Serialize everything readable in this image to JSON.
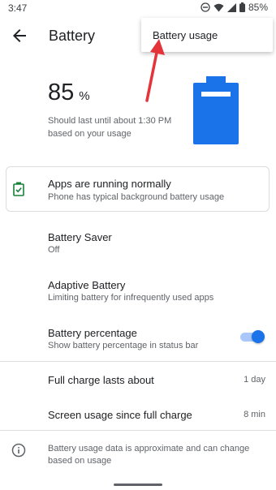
{
  "status_bar": {
    "time": "3:47",
    "battery_text": "85%"
  },
  "header": {
    "title": "Battery"
  },
  "menu": {
    "item": "Battery usage"
  },
  "summary": {
    "level": "85",
    "unit": "%",
    "estimate": "Should last until about 1:30 PM based on your usage",
    "level_fraction": 0.85,
    "battery_color": "#1a73e8"
  },
  "tip_card": {
    "title": "Apps are running normally",
    "subtitle": "Phone has typical background battery usage",
    "icon_color": "#188038"
  },
  "settings": [
    {
      "title": "Battery Saver",
      "subtitle": "Off"
    },
    {
      "title": "Adaptive Battery",
      "subtitle": "Limiting battery for infrequently used apps"
    },
    {
      "title": "Battery percentage",
      "subtitle": "Show battery percentage in status bar",
      "toggle_on": true
    }
  ],
  "stats": [
    {
      "label": "Full charge lasts about",
      "value": "1 day"
    },
    {
      "label": "Screen usage since full charge",
      "value": "8 min"
    }
  ],
  "footer": {
    "text": "Battery usage data is approximate and can change based on usage"
  },
  "accent_color": "#1a73e8",
  "annotation_arrow_color": "#e5333a"
}
